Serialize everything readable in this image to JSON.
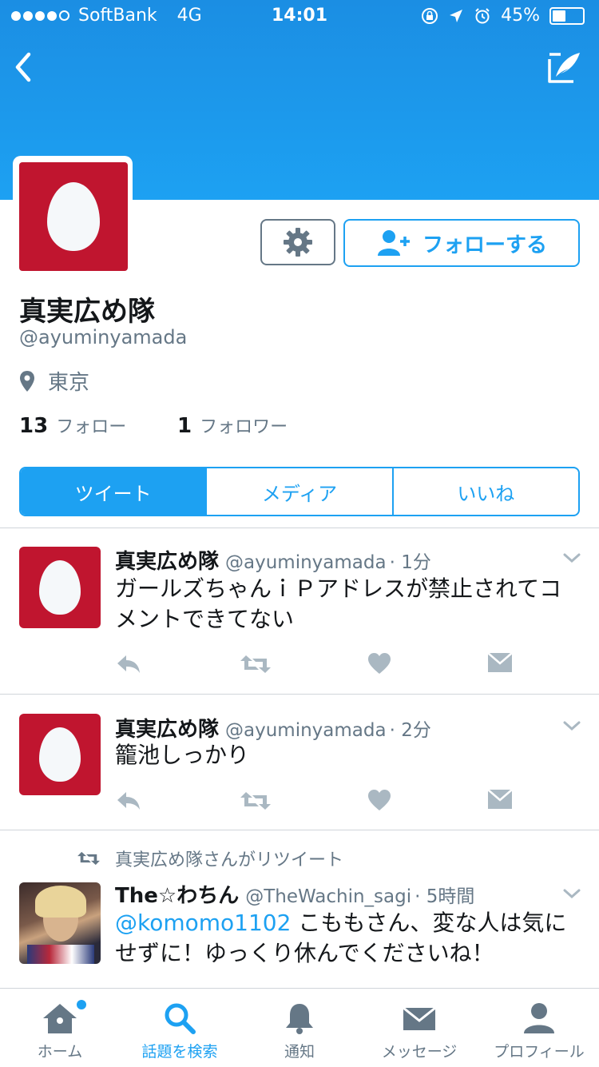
{
  "status_bar": {
    "carrier": "SoftBank",
    "network": "4G",
    "time": "14:01",
    "battery": "45%",
    "battery_level": 0.45
  },
  "profile": {
    "name": "真実広め隊",
    "handle": "@ayuminyamada",
    "location": "東京",
    "following_count": "13",
    "following_label": "フォロー",
    "followers_count": "1",
    "followers_label": "フォロワー",
    "follow_button": "フォローする"
  },
  "tabs": [
    {
      "label": "ツイート",
      "active": true
    },
    {
      "label": "メディア",
      "active": false
    },
    {
      "label": "いいね",
      "active": false
    }
  ],
  "tweets": [
    {
      "name": "真実広め隊",
      "handle": "@ayuminyamada",
      "time": "· 1分",
      "text": "ガールズちゃんｉＰアドレスが禁止されてコメントできてない"
    },
    {
      "name": "真実広め隊",
      "handle": "@ayuminyamada",
      "time": "· 2分",
      "text": "籠池しっかり"
    },
    {
      "retweet_label": "真実広め隊さんがリツイート",
      "name": "The☆わちん",
      "handle": "@TheWachin_sagi",
      "time": "· 5時間",
      "mention": "@komomo1102",
      "text": " こももさん、変な人は気にせずに！ゆっくり休んでくださいね！"
    }
  ],
  "tabbar": [
    {
      "label": "ホーム",
      "icon": "home-icon"
    },
    {
      "label": "話題を検索",
      "icon": "search-icon",
      "active": true
    },
    {
      "label": "通知",
      "icon": "bell-icon"
    },
    {
      "label": "メッセージ",
      "icon": "envelope-icon"
    },
    {
      "label": "プロフィール",
      "icon": "person-icon"
    }
  ],
  "colors": {
    "accent": "#1da1f2",
    "avatar_bg": "#c0152f",
    "muted": "#657786"
  }
}
